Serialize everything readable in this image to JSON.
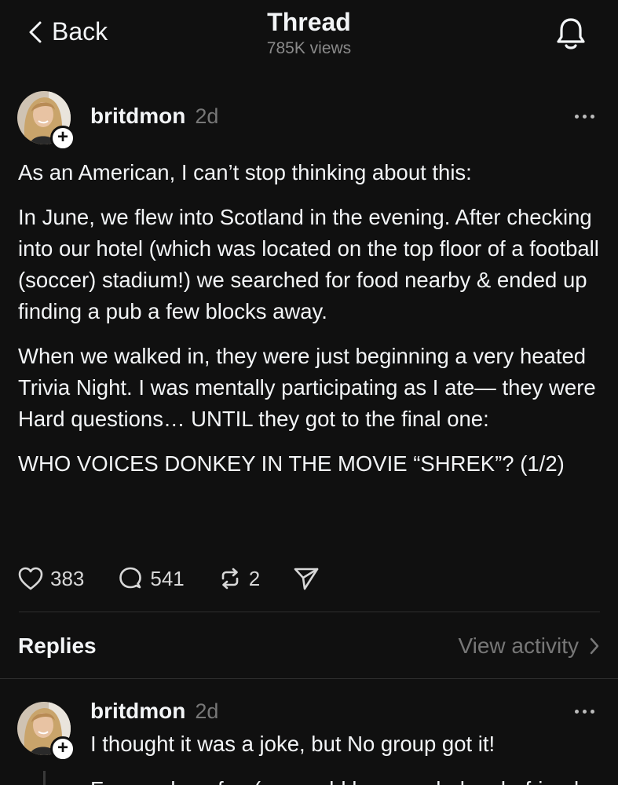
{
  "header": {
    "back_label": "Back",
    "title": "Thread",
    "views": "785K views"
  },
  "post": {
    "username": "britdmon",
    "time": "2d",
    "paragraphs": [
      "As an American, I can’t stop thinking about this:",
      "In June, we flew into Scotland in the evening. After checking into our hotel (which was located on the top floor of a football (soccer) stadium!) we searched for food nearby & ended up finding a pub a few blocks away.",
      "When we walked in, they were just beginning a very heated Trivia Night. I was mentally participating as I ate— they were Hard questions…  UNTIL they got to the final one:",
      "WHO VOICES DONKEY IN THE MOVIE “SHREK”? (1/2)"
    ],
    "likes": "383",
    "replies": "541",
    "reposts": "2"
  },
  "replies_section": {
    "label": "Replies",
    "view_activity": "View activity"
  },
  "reply": {
    "username": "britdmon",
    "time": "2d",
    "text": "I thought it was a joke, but No group got it!",
    "next_text": "For a pub so fun (we could have ended up befriend"
  }
}
